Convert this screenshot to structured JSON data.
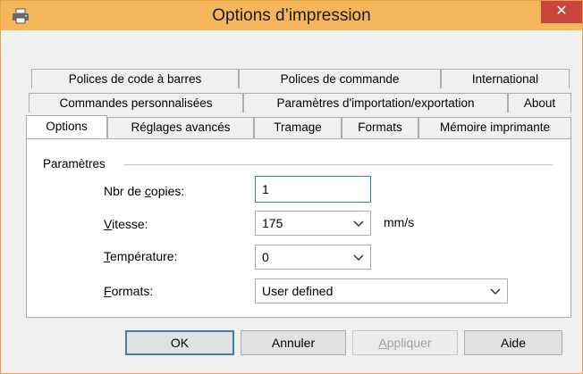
{
  "window": {
    "title": "Options d’impression",
    "close_glyph": "✕"
  },
  "tabs": {
    "row1": [
      "Polices de code à barres",
      "Polices de commande",
      "International"
    ],
    "row2": [
      "Commandes personnalisées",
      "Paramètres d'importation/exportation",
      "About"
    ],
    "row3": [
      "Options",
      "Réglages avancés",
      "Tramage",
      "Formats",
      "Mémoire imprimante"
    ],
    "active": "Options"
  },
  "panel": {
    "group_label": "Paramètres",
    "copies": {
      "label_pre": "Nbr de ",
      "label_key": "c",
      "label_post": "opies:",
      "value": "1"
    },
    "speed": {
      "label_key": "V",
      "label_post": "itesse:",
      "value": "175",
      "unit": "mm/s"
    },
    "temperature": {
      "label_key": "T",
      "label_post": "empérature:",
      "value": "0"
    },
    "formats": {
      "label_key": "F",
      "label_post": "ormats:",
      "value": "User defined"
    }
  },
  "buttons": {
    "ok": "OK",
    "cancel": "Annuler",
    "apply_key": "A",
    "apply_post": "ppliquer",
    "help": "Aide"
  },
  "icons": {
    "app": "printer-icon",
    "dropdown": "chevron-down-icon"
  }
}
